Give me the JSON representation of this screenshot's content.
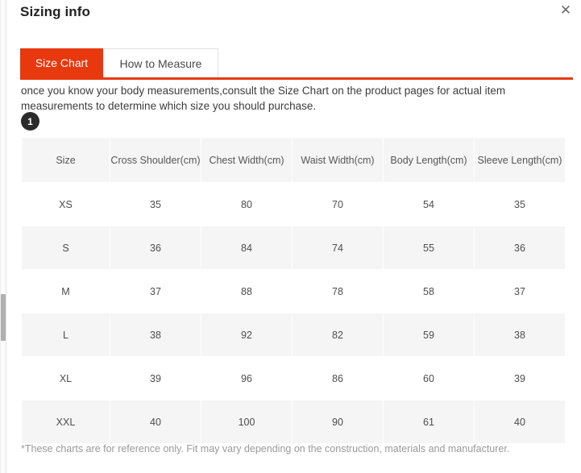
{
  "dialog": {
    "title": "Sizing info",
    "close_icon": "close-icon",
    "close_glyph": "✕"
  },
  "tabs": [
    {
      "label": "Size Chart",
      "active": true
    },
    {
      "label": "How to Measure",
      "active": false
    }
  ],
  "description": {
    "text": "once you know your body measurements,consult the Size Chart on the product pages for actual item measurements to determine which size you should purchase.",
    "step_badge": "1"
  },
  "table": {
    "headers": [
      "Size",
      "Cross Shoulder(cm)",
      "Chest Width(cm)",
      "Waist Width(cm)",
      "Body Length(cm)",
      "Sleeve Length(cm)"
    ],
    "rows": [
      {
        "size": "XS",
        "cross_shoulder": "35",
        "chest_width": "80",
        "waist_width": "70",
        "body_length": "54",
        "sleeve_length": "35"
      },
      {
        "size": "S",
        "cross_shoulder": "36",
        "chest_width": "84",
        "waist_width": "74",
        "body_length": "55",
        "sleeve_length": "36"
      },
      {
        "size": "M",
        "cross_shoulder": "37",
        "chest_width": "88",
        "waist_width": "78",
        "body_length": "58",
        "sleeve_length": "37"
      },
      {
        "size": "L",
        "cross_shoulder": "38",
        "chest_width": "92",
        "waist_width": "82",
        "body_length": "59",
        "sleeve_length": "38"
      },
      {
        "size": "XL",
        "cross_shoulder": "39",
        "chest_width": "96",
        "waist_width": "86",
        "body_length": "60",
        "sleeve_length": "39"
      },
      {
        "size": "XXL",
        "cross_shoulder": "40",
        "chest_width": "100",
        "waist_width": "90",
        "body_length": "61",
        "sleeve_length": "40"
      }
    ]
  },
  "footer": {
    "note": "*These charts are for reference only. Fit may vary depending on the construction, materials and manufacturer."
  },
  "colors": {
    "accent": "#e8380d",
    "header_bg": "#f5f5f5",
    "row_alt_bg": "#f5f5f5",
    "badge_bg": "#2b2b2b",
    "muted_text": "#9a9a9a"
  }
}
